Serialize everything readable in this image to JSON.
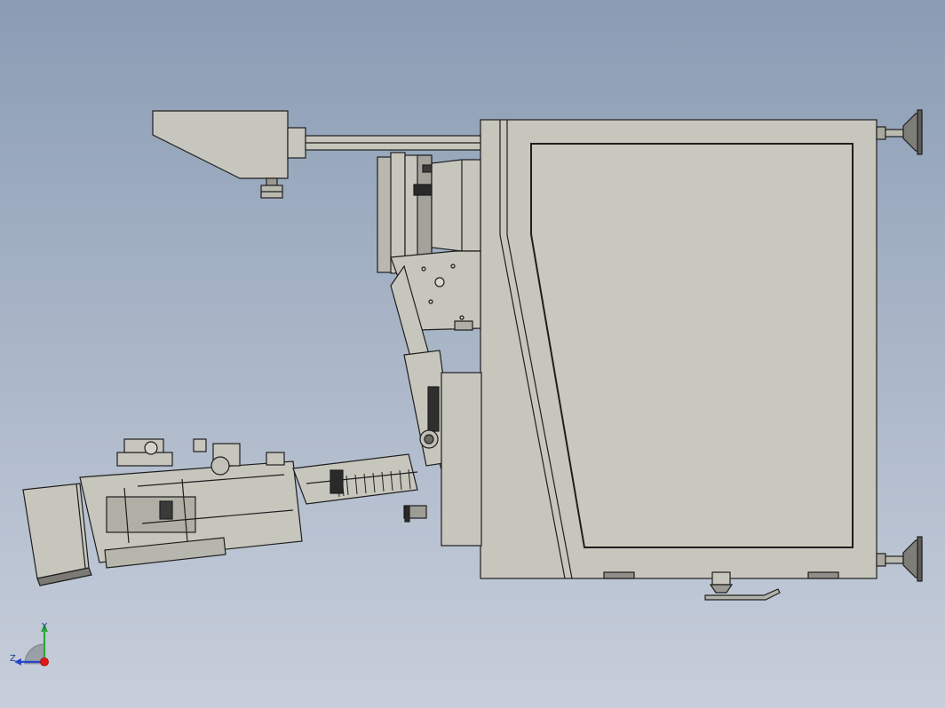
{
  "viewport": {
    "background_top": "#8a9cb4",
    "background_bottom": "#c7cedb",
    "part_fill": "#c7c6bd",
    "edge_color": "#1e1e1e"
  },
  "triad": {
    "y_label": "Y",
    "z_label": "Z",
    "y_axis_color": "#2ea836",
    "z_axis_color": "#2845c8",
    "origin_color": "#e01818"
  }
}
